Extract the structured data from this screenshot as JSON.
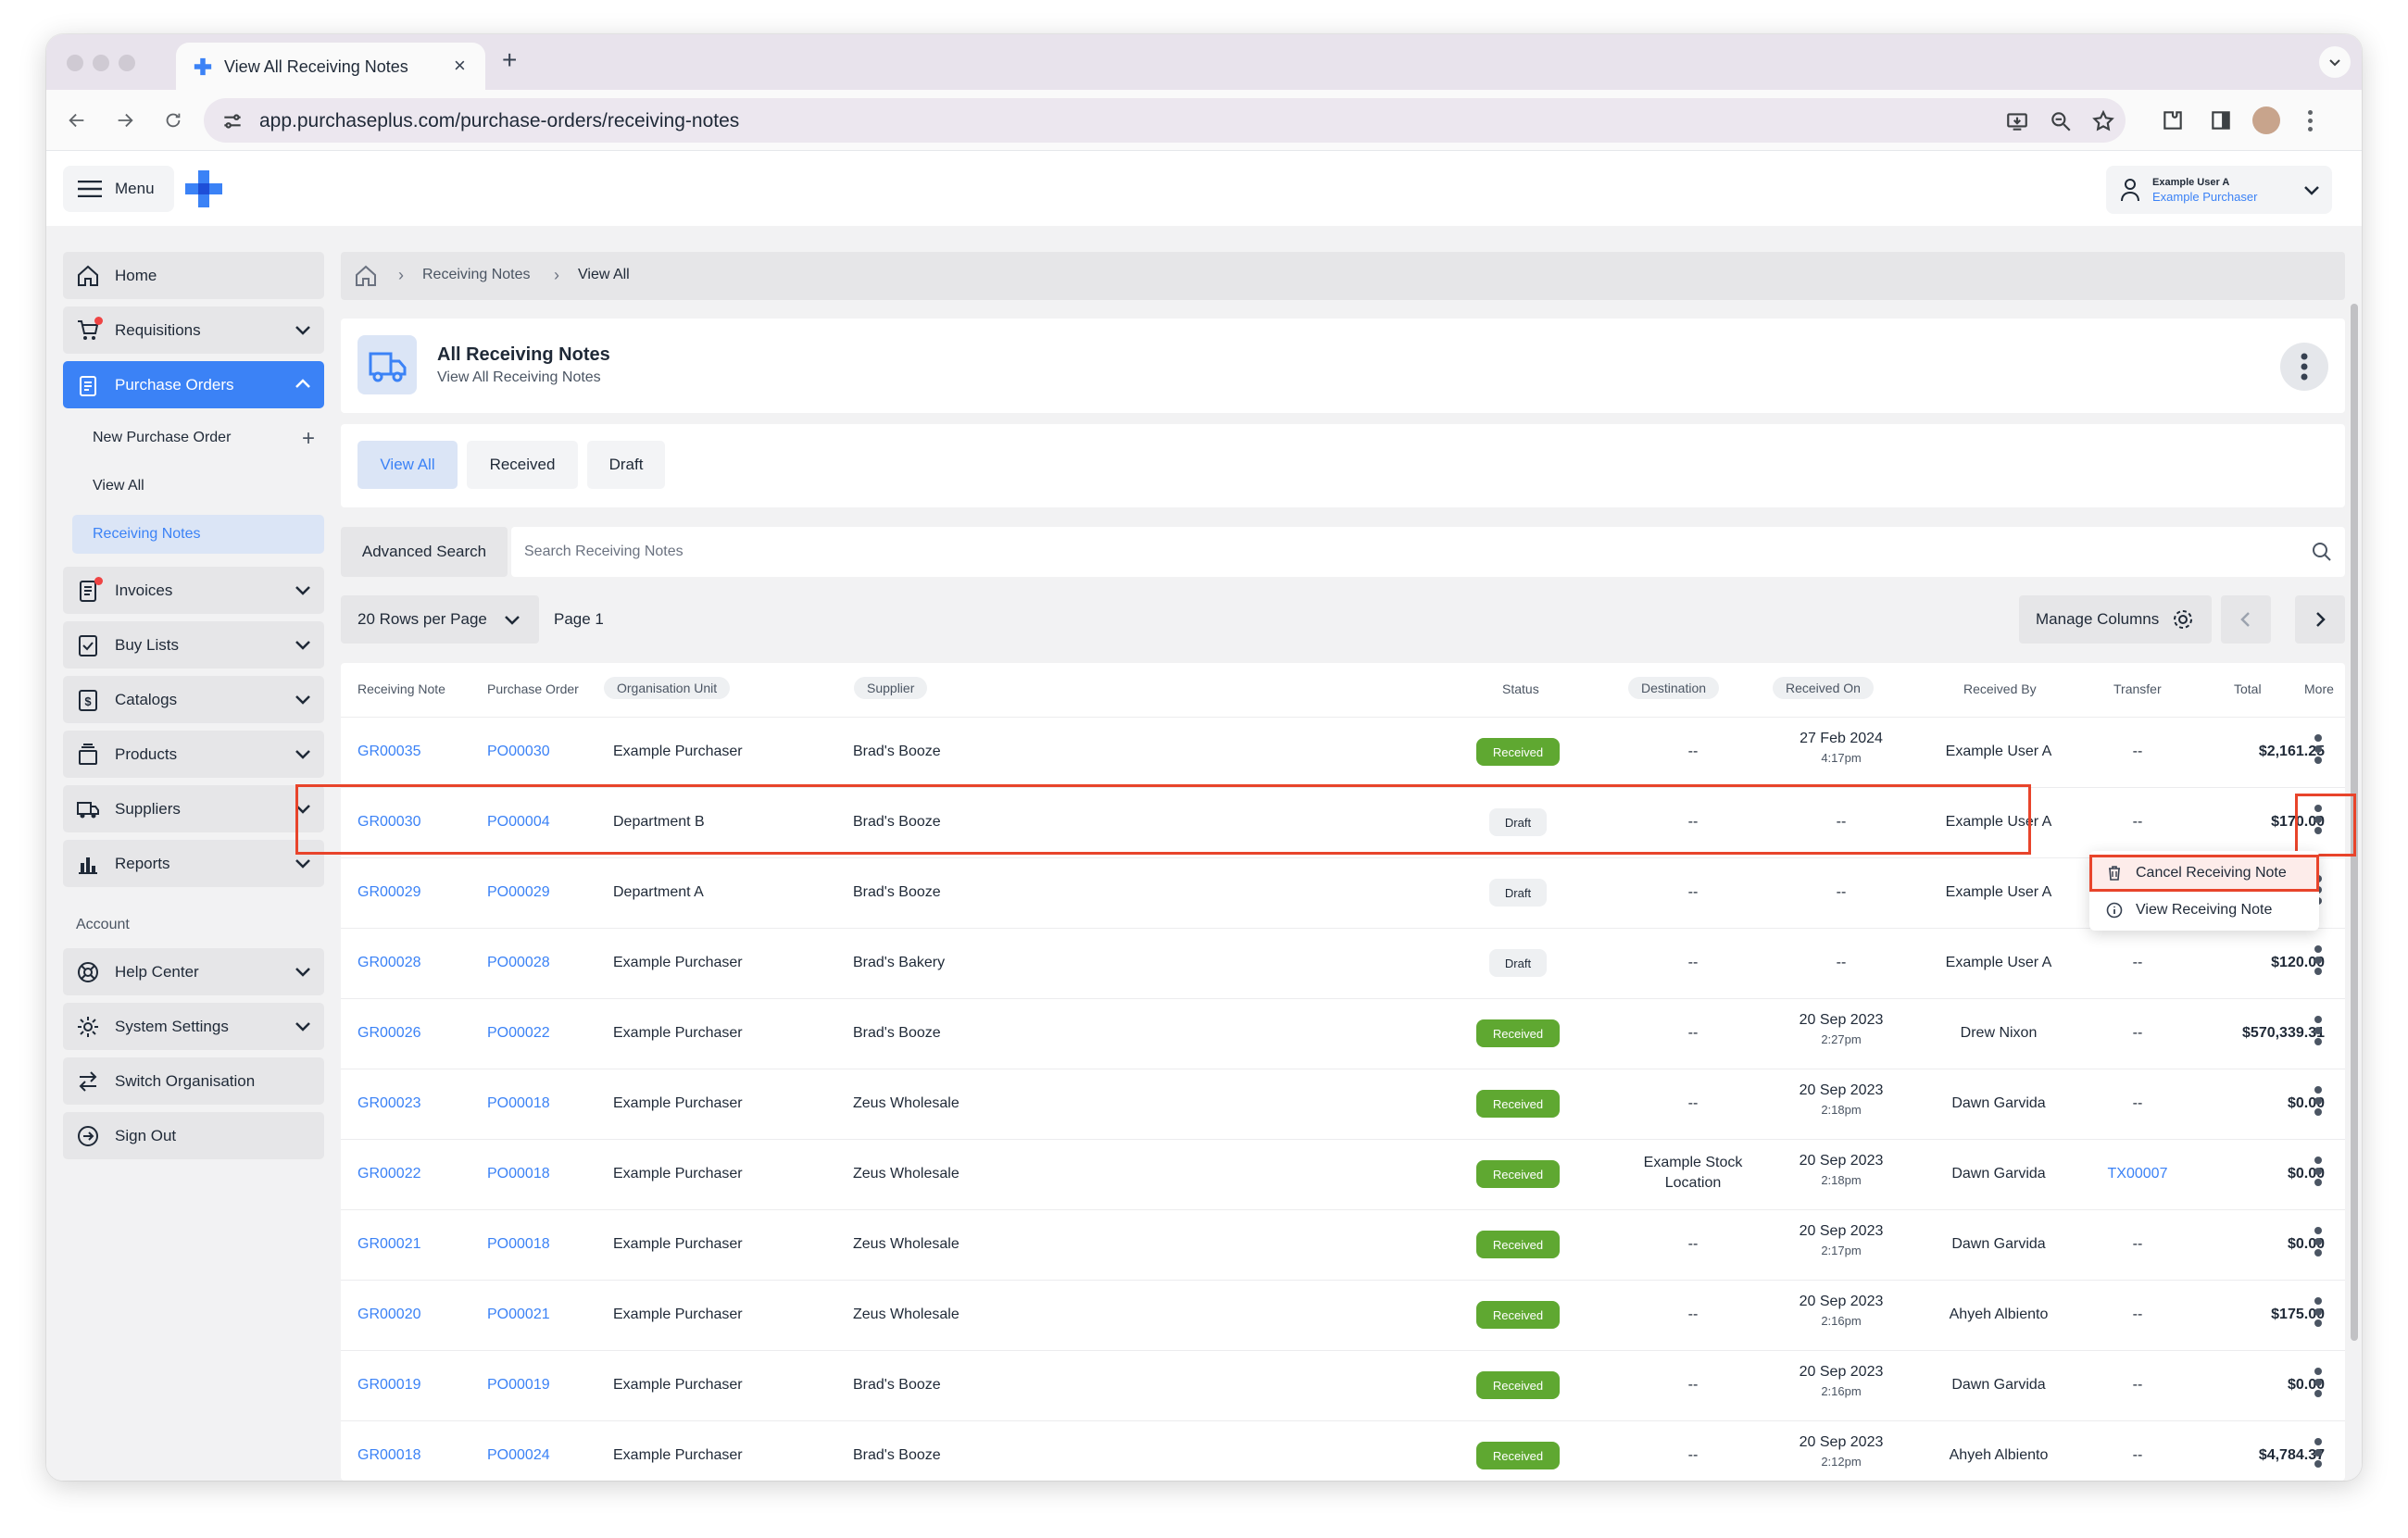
{
  "browser": {
    "tab_title": "View All Receiving Notes",
    "url": "app.purchaseplus.com/purchase-orders/receiving-notes"
  },
  "header": {
    "menu_label": "Menu",
    "user_name": "Example User A",
    "user_org": "Example Purchaser"
  },
  "sidebar": {
    "items": [
      {
        "label": "Home",
        "icon": "home-icon"
      },
      {
        "label": "Requisitions",
        "icon": "cart-icon"
      },
      {
        "label": "Purchase Orders",
        "icon": "clipboard-icon"
      },
      {
        "label": "Invoices",
        "icon": "invoice-icon"
      },
      {
        "label": "Buy Lists",
        "icon": "checklist-icon"
      },
      {
        "label": "Catalogs",
        "icon": "dollar-doc-icon"
      },
      {
        "label": "Products",
        "icon": "box-icon"
      },
      {
        "label": "Suppliers",
        "icon": "truck-icon"
      },
      {
        "label": "Reports",
        "icon": "bar-chart-icon"
      }
    ],
    "sub_items": [
      {
        "label": "New Purchase Order"
      },
      {
        "label": "View All"
      },
      {
        "label": "Receiving Notes"
      }
    ],
    "account_heading": "Account",
    "account_items": [
      {
        "label": "Help Center",
        "icon": "lifebuoy-icon"
      },
      {
        "label": "System Settings",
        "icon": "gear-icon"
      },
      {
        "label": "Switch Organisation",
        "icon": "switch-icon"
      },
      {
        "label": "Sign Out",
        "icon": "sign-out-icon"
      }
    ]
  },
  "breadcrumb": {
    "items": [
      "Receiving Notes",
      "View All"
    ]
  },
  "page": {
    "title": "All Receiving Notes",
    "subtitle": "View All Receiving Notes"
  },
  "filter_tabs": [
    "View All",
    "Received",
    "Draft"
  ],
  "search": {
    "advanced_label": "Advanced Search",
    "placeholder": "Search Receiving Notes"
  },
  "pagination": {
    "rows_per_page": "20 Rows per Page",
    "page_label": "Page 1",
    "manage_columns": "Manage Columns"
  },
  "table": {
    "columns": [
      "Receiving Note",
      "Purchase Order",
      "Organisation Unit",
      "Supplier",
      "Status",
      "Destination",
      "Received On",
      "Received By",
      "Transfer",
      "Total",
      "More"
    ],
    "rows": [
      {
        "note": "GR00035",
        "po": "PO00030",
        "unit": "Example Purchaser",
        "supplier": "Brad's Booze",
        "status": "Received",
        "destination": "--",
        "date": "27 Feb 2024",
        "time": "4:17pm",
        "by": "Example User A",
        "transfer": "--",
        "total": "$2,161.25"
      },
      {
        "note": "GR00030",
        "po": "PO00004",
        "unit": "Department B",
        "supplier": "Brad's Booze",
        "status": "Draft",
        "destination": "--",
        "date": "--",
        "time": "",
        "by": "Example User A",
        "transfer": "--",
        "total": "$170.00"
      },
      {
        "note": "GR00029",
        "po": "PO00029",
        "unit": "Department A",
        "supplier": "Brad's Booze",
        "status": "Draft",
        "destination": "--",
        "date": "--",
        "time": "",
        "by": "Example User A",
        "transfer": "",
        "total": ""
      },
      {
        "note": "GR00028",
        "po": "PO00028",
        "unit": "Example Purchaser",
        "supplier": "Brad's Bakery",
        "status": "Draft",
        "destination": "--",
        "date": "--",
        "time": "",
        "by": "Example User A",
        "transfer": "--",
        "total": "$120.00"
      },
      {
        "note": "GR00026",
        "po": "PO00022",
        "unit": "Example Purchaser",
        "supplier": "Brad's Booze",
        "status": "Received",
        "destination": "--",
        "date": "20 Sep 2023",
        "time": "2:27pm",
        "by": "Drew Nixon",
        "transfer": "--",
        "total": "$570,339.31"
      },
      {
        "note": "GR00023",
        "po": "PO00018",
        "unit": "Example Purchaser",
        "supplier": "Zeus Wholesale",
        "status": "Received",
        "destination": "--",
        "date": "20 Sep 2023",
        "time": "2:18pm",
        "by": "Dawn Garvida",
        "transfer": "--",
        "total": "$0.00"
      },
      {
        "note": "GR00022",
        "po": "PO00018",
        "unit": "Example Purchaser",
        "supplier": "Zeus Wholesale",
        "status": "Received",
        "destination": "Example Stock Location",
        "date": "20 Sep 2023",
        "time": "2:18pm",
        "by": "Dawn Garvida",
        "transfer": "TX00007",
        "total": "$0.00"
      },
      {
        "note": "GR00021",
        "po": "PO00018",
        "unit": "Example Purchaser",
        "supplier": "Zeus Wholesale",
        "status": "Received",
        "destination": "--",
        "date": "20 Sep 2023",
        "time": "2:17pm",
        "by": "Dawn Garvida",
        "transfer": "--",
        "total": "$0.00"
      },
      {
        "note": "GR00020",
        "po": "PO00021",
        "unit": "Example Purchaser",
        "supplier": "Zeus Wholesale",
        "status": "Received",
        "destination": "--",
        "date": "20 Sep 2023",
        "time": "2:16pm",
        "by": "Ahyeh Albiento",
        "transfer": "--",
        "total": "$175.00"
      },
      {
        "note": "GR00019",
        "po": "PO00019",
        "unit": "Example Purchaser",
        "supplier": "Brad's Booze",
        "status": "Received",
        "destination": "--",
        "date": "20 Sep 2023",
        "time": "2:16pm",
        "by": "Dawn Garvida",
        "transfer": "--",
        "total": "$0.00"
      },
      {
        "note": "GR00018",
        "po": "PO00024",
        "unit": "Example Purchaser",
        "supplier": "Brad's Booze",
        "status": "Received",
        "destination": "--",
        "date": "20 Sep 2023",
        "time": "2:12pm",
        "by": "Ahyeh Albiento",
        "transfer": "--",
        "total": "$4,784.37"
      }
    ]
  },
  "row_menu": {
    "items": [
      {
        "label": "Cancel Receiving Note",
        "icon": "trash-icon"
      },
      {
        "label": "View Receiving Note",
        "icon": "info-icon"
      }
    ]
  },
  "colors": {
    "accent": "#3b82f6",
    "received_badge": "#5fa831",
    "highlight": "#e8442b"
  }
}
